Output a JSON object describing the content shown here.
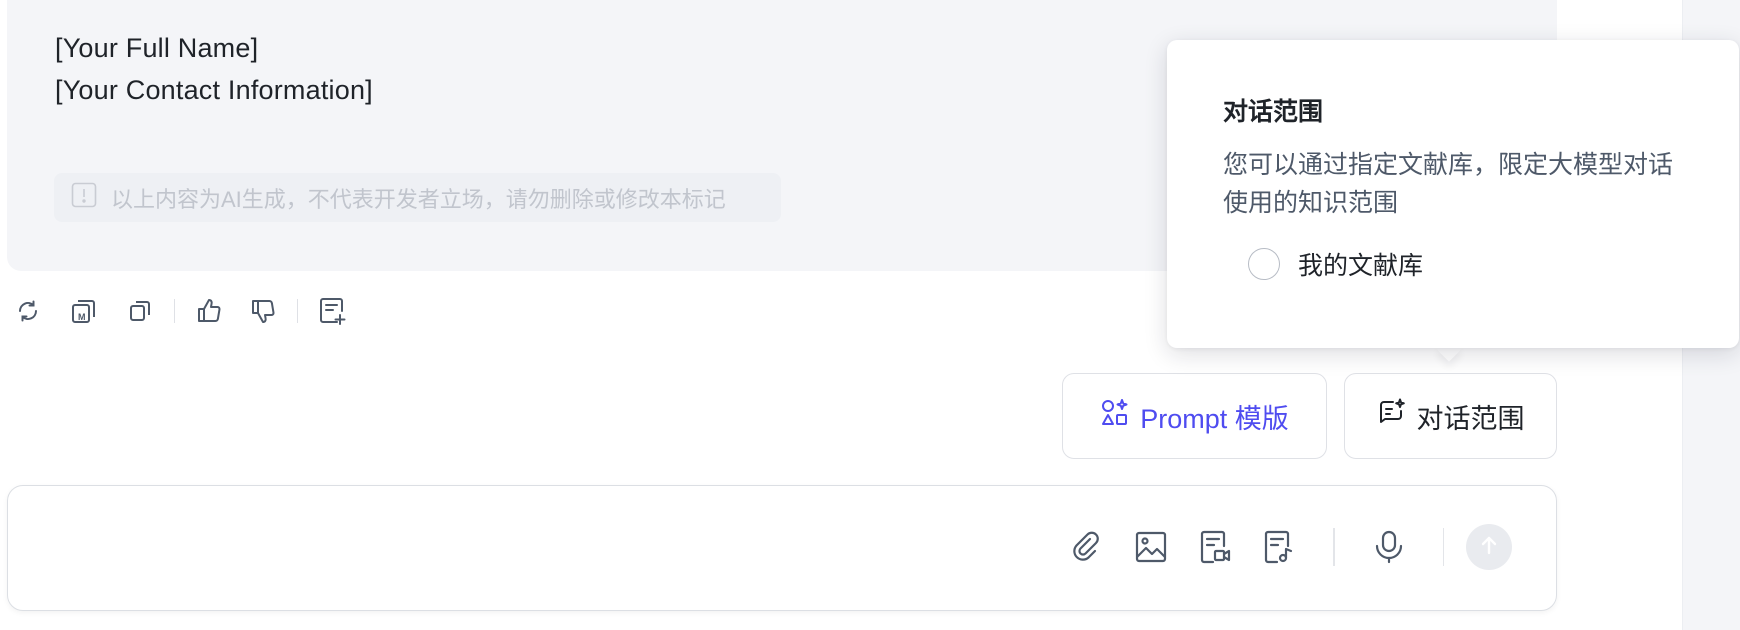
{
  "message": {
    "signature_name": "[Your Full Name]",
    "signature_contact": "[Your Contact Information]",
    "disclaimer": "以上内容为AI生成，不代表开发者立场，请勿删除或修改本标记"
  },
  "actions": {
    "icons": [
      "regenerate-icon",
      "copy-markdown-icon",
      "copy-icon",
      "thumbs-up-icon",
      "thumbs-down-icon",
      "add-note-icon"
    ]
  },
  "chips": {
    "prompt_label": "Prompt 模版",
    "scope_label": "对话范围"
  },
  "input": {
    "placeholder": "",
    "tools": [
      "attachment-icon",
      "image-icon",
      "video-doc-icon",
      "audio-doc-icon",
      "microphone-icon",
      "send-arrow-icon"
    ]
  },
  "popover": {
    "title": "对话范围",
    "description": "您可以通过指定文献库，限定大模型对话使用的知识范围",
    "options": [
      {
        "label": "我的文献库",
        "selected": false
      }
    ]
  },
  "colors": {
    "accent": "#4f4cf0",
    "card_bg": "#f4f5f8",
    "icon": "#4e5969"
  }
}
